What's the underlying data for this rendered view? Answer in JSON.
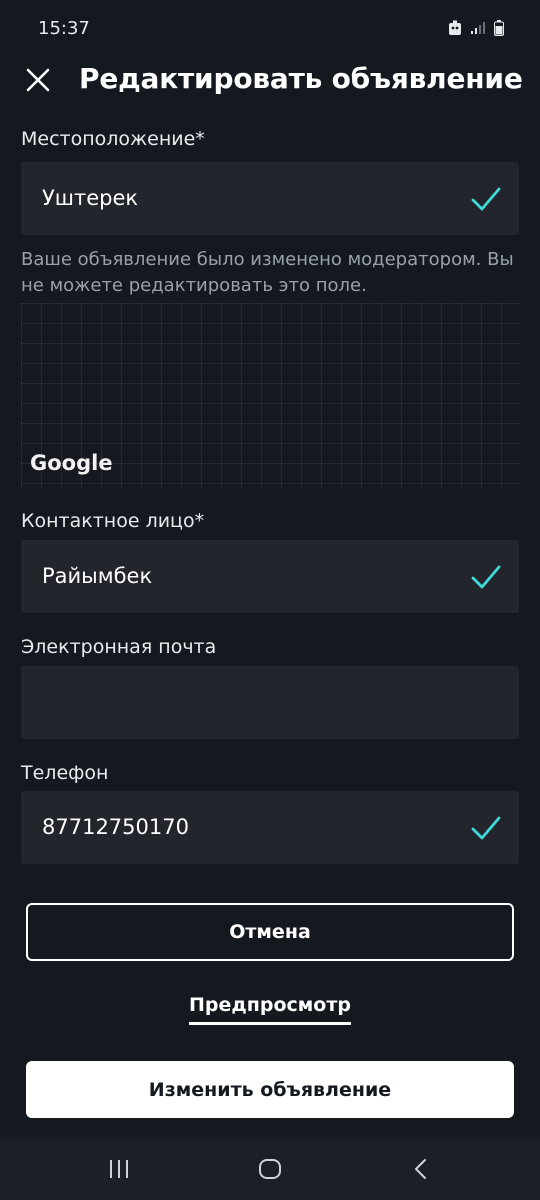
{
  "status_bar": {
    "time": "15:37"
  },
  "header": {
    "title": "Редактировать объявление"
  },
  "location": {
    "label": "Местоположение*",
    "value": "Уштерек",
    "note": "Ваше объявление было изменено модератором. Вы не можете редактировать это поле."
  },
  "map": {
    "logo_text": "Google"
  },
  "contact": {
    "label": "Контактное лицо*",
    "value": "Райымбек"
  },
  "email": {
    "label": "Электронная почта",
    "value": ""
  },
  "phone": {
    "label": "Телефон",
    "value": "87712750170"
  },
  "actions": {
    "cancel_label": "Отмена",
    "preview_label": "Предпросмотр",
    "submit_label": "Изменить объявление"
  },
  "colors": {
    "background": "#141920",
    "field": "#22252b",
    "accent_check": "#3fd9d9"
  }
}
